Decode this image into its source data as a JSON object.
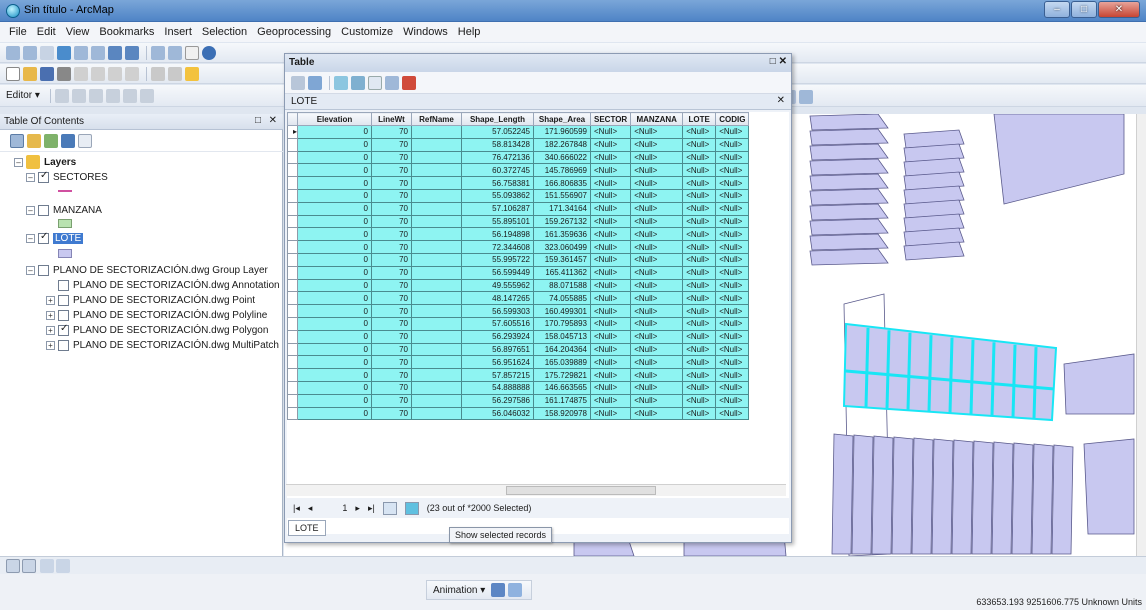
{
  "window": {
    "title": "Sin título - ArcMap",
    "controls": [
      "–",
      "□",
      "✕"
    ]
  },
  "menu": [
    "File",
    "Edit",
    "View",
    "Bookmarks",
    "Insert",
    "Selection",
    "Geoprocessing",
    "Customize",
    "Windows",
    "Help"
  ],
  "editor_toolbar": {
    "label": "Editor ▾"
  },
  "toc": {
    "title": "Table Of Contents",
    "layers_label": "Layers",
    "items": [
      {
        "name": "SECTORES",
        "checked": true
      },
      {
        "name": "MANZANA",
        "checked": false
      },
      {
        "name": "LOTE",
        "checked": true,
        "selected": true
      },
      {
        "name": "PLANO DE SECTORIZACIÓN.dwg Group Layer",
        "checked": false
      },
      {
        "name": "PLANO DE SECTORIZACIÓN.dwg Annotation",
        "checked": false
      },
      {
        "name": "PLANO DE SECTORIZACIÓN.dwg Point",
        "checked": false
      },
      {
        "name": "PLANO DE SECTORIZACIÓN.dwg Polyline",
        "checked": false
      },
      {
        "name": "PLANO DE SECTORIZACIÓN.dwg Polygon",
        "checked": true
      },
      {
        "name": "PLANO DE SECTORIZACIÓN.dwg MultiPatch",
        "checked": false
      }
    ]
  },
  "table": {
    "window_title": "Table",
    "tab": "LOTE",
    "columns": [
      "Elevation",
      "LineWt",
      "RefName",
      "Shape_Length",
      "Shape_Area",
      "SECTOR",
      "MANZANA",
      "LOTE",
      "CODIG"
    ],
    "rows": [
      [
        "0",
        "70",
        "",
        "57.052245",
        "171.960599",
        "<Null>",
        "<Null>",
        "<Null>",
        "<Null>"
      ],
      [
        "0",
        "70",
        "",
        "58.813428",
        "182.267848",
        "<Null>",
        "<Null>",
        "<Null>",
        "<Null>"
      ],
      [
        "0",
        "70",
        "",
        "76.472136",
        "340.666022",
        "<Null>",
        "<Null>",
        "<Null>",
        "<Null>"
      ],
      [
        "0",
        "70",
        "",
        "60.372745",
        "145.786969",
        "<Null>",
        "<Null>",
        "<Null>",
        "<Null>"
      ],
      [
        "0",
        "70",
        "",
        "56.758381",
        "166.806835",
        "<Null>",
        "<Null>",
        "<Null>",
        "<Null>"
      ],
      [
        "0",
        "70",
        "",
        "55.093862",
        "151.556907",
        "<Null>",
        "<Null>",
        "<Null>",
        "<Null>"
      ],
      [
        "0",
        "70",
        "",
        "57.106287",
        "171.34164",
        "<Null>",
        "<Null>",
        "<Null>",
        "<Null>"
      ],
      [
        "0",
        "70",
        "",
        "55.895101",
        "159.267132",
        "<Null>",
        "<Null>",
        "<Null>",
        "<Null>"
      ],
      [
        "0",
        "70",
        "",
        "56.194898",
        "161.359636",
        "<Null>",
        "<Null>",
        "<Null>",
        "<Null>"
      ],
      [
        "0",
        "70",
        "",
        "72.344608",
        "323.060499",
        "<Null>",
        "<Null>",
        "<Null>",
        "<Null>"
      ],
      [
        "0",
        "70",
        "",
        "55.995722",
        "159.361457",
        "<Null>",
        "<Null>",
        "<Null>",
        "<Null>"
      ],
      [
        "0",
        "70",
        "",
        "56.599449",
        "165.411362",
        "<Null>",
        "<Null>",
        "<Null>",
        "<Null>"
      ],
      [
        "0",
        "70",
        "",
        "49.555962",
        "88.071588",
        "<Null>",
        "<Null>",
        "<Null>",
        "<Null>"
      ],
      [
        "0",
        "70",
        "",
        "48.147265",
        "74.055885",
        "<Null>",
        "<Null>",
        "<Null>",
        "<Null>"
      ],
      [
        "0",
        "70",
        "",
        "56.599303",
        "160.499301",
        "<Null>",
        "<Null>",
        "<Null>",
        "<Null>"
      ],
      [
        "0",
        "70",
        "",
        "57.605516",
        "170.795893",
        "<Null>",
        "<Null>",
        "<Null>",
        "<Null>"
      ],
      [
        "0",
        "70",
        "",
        "56.293924",
        "158.045713",
        "<Null>",
        "<Null>",
        "<Null>",
        "<Null>"
      ],
      [
        "0",
        "70",
        "",
        "56.897651",
        "164.204364",
        "<Null>",
        "<Null>",
        "<Null>",
        "<Null>"
      ],
      [
        "0",
        "70",
        "",
        "56.951624",
        "165.039889",
        "<Null>",
        "<Null>",
        "<Null>",
        "<Null>"
      ],
      [
        "0",
        "70",
        "",
        "57.857215",
        "175.729821",
        "<Null>",
        "<Null>",
        "<Null>",
        "<Null>"
      ],
      [
        "0",
        "70",
        "",
        "54.888888",
        "146.663565",
        "<Null>",
        "<Null>",
        "<Null>",
        "<Null>"
      ],
      [
        "0",
        "70",
        "",
        "56.297586",
        "161.174875",
        "<Null>",
        "<Null>",
        "<Null>",
        "<Null>"
      ],
      [
        "0",
        "70",
        "",
        "56.046032",
        "158.920978",
        "<Null>",
        "<Null>",
        "<Null>",
        "<Null>"
      ]
    ],
    "record_position": "1",
    "selection_summary": "(23 out of *2000 Selected)",
    "bottom_tab": "LOTE",
    "tooltip": "Show selected records"
  },
  "status": {
    "animation_label": "Animation ▾",
    "coordinates": "633653.193 9251606.775 Unknown Units"
  },
  "colors": {
    "selection": "#8ef4f2",
    "parcel_fill": "#c8c8f0",
    "parcel_stroke": "#5a5a8c",
    "selected_stroke": "#19e6f5"
  }
}
